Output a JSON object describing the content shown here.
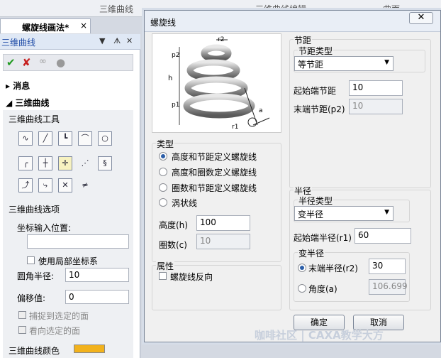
{
  "app": {
    "menu_items": [
      "三维曲线",
      "三维曲线编辑",
      "曲面"
    ],
    "doc_tab": "螺旋线画法*",
    "doc_tab_close": "×"
  },
  "panel": {
    "title": "三维曲线",
    "controls": [
      "▼",
      "ᗑ",
      "✕"
    ],
    "messages": "消息",
    "section": "三维曲线",
    "tools_title": "三维曲线工具",
    "options_title": "三维曲线选项",
    "coord_label": "坐标输入位置:",
    "coord_value": "",
    "local_coord": "使用局部坐标系",
    "fillet_label": "圆角半径:",
    "fillet_value": "10",
    "offset_label": "偏移值:",
    "offset_value": "0",
    "snap_label": "捕捉到选定的面",
    "view_label": "看向选定的面",
    "color_label": "三维曲线颜色",
    "color_hex": "#f2b21c"
  },
  "dialog": {
    "title": "螺旋线",
    "close": "✕",
    "diagram_labels": {
      "r2": "r2",
      "p2": "p2",
      "h": "h",
      "p1": "p1",
      "r1": "r1",
      "a": "a"
    },
    "type_group": "类型",
    "types": [
      "高度和节距定义螺旋线",
      "高度和圈数定义螺旋线",
      "圈数和节距定义螺旋线",
      "涡状线"
    ],
    "type_selected": 0,
    "height_label": "高度(h)",
    "height_value": "100",
    "turns_label": "圈数(c)",
    "turns_value": "10",
    "attr_group": "属性",
    "reverse_label": "螺旋线反向",
    "pitch_group": "节距",
    "pitch_type_group": "节距类型",
    "pitch_type_value": "等节距",
    "start_pitch_label": "起始端节距",
    "start_pitch_value": "10",
    "end_pitch_label": "末端节距(p2)",
    "end_pitch_value": "10",
    "radius_group": "半径",
    "radius_type_group": "半径类型",
    "radius_type_value": "变半径",
    "start_radius_label": "起始端半径(r1)",
    "start_radius_value": "60",
    "var_radius_group": "变半径",
    "end_radius_label": "末端半径(r2)",
    "end_radius_value": "30",
    "angle_label": "角度(a)",
    "angle_value": "106.699",
    "ok": "确定",
    "cancel": "取消"
  },
  "watermark": "咖啡社区 | CAXA教学大方"
}
